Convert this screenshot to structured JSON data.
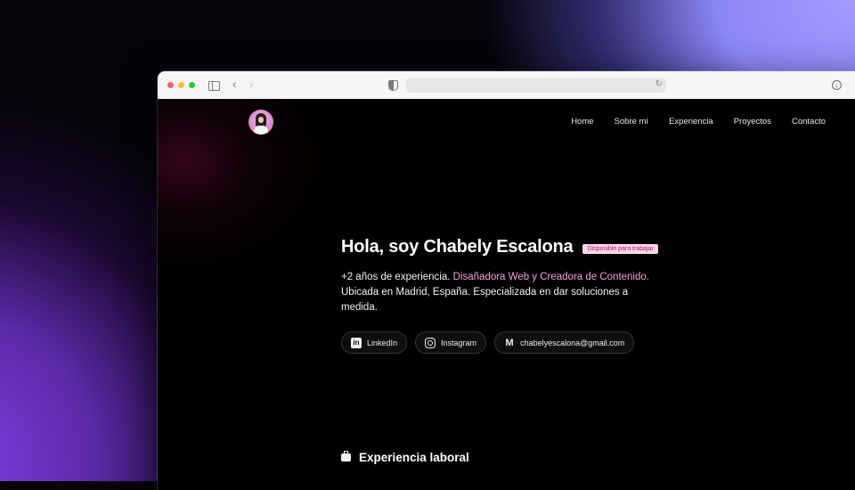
{
  "nav": {
    "items": [
      "Home",
      "Sobre mí",
      "Experiencia",
      "Proyectos",
      "Contacto"
    ]
  },
  "hero": {
    "title": "Hola, soy Chabely Escalona",
    "badge": "Disponible para trabajar",
    "desc_prefix": "+2 años de experiencia. ",
    "desc_highlight": "Disañadora Web y Creadora de Contenido.",
    "desc_rest": " Ubicada en Madrid, España. Especializada en dar soluciones a medida."
  },
  "socials": [
    {
      "label": "LinkedIn",
      "icon": "linkedin-icon"
    },
    {
      "label": "Instagram",
      "icon": "instagram-icon"
    },
    {
      "label": "chabelyescalona@gmail.com",
      "icon": "gmail-icon"
    }
  ],
  "section": {
    "title": "Experiencia laboral",
    "icon": "briefcase-icon"
  },
  "colors": {
    "accent": "#f2a2d4",
    "badge_bg": "#fbd5e8",
    "badge_text": "#b0225e"
  }
}
